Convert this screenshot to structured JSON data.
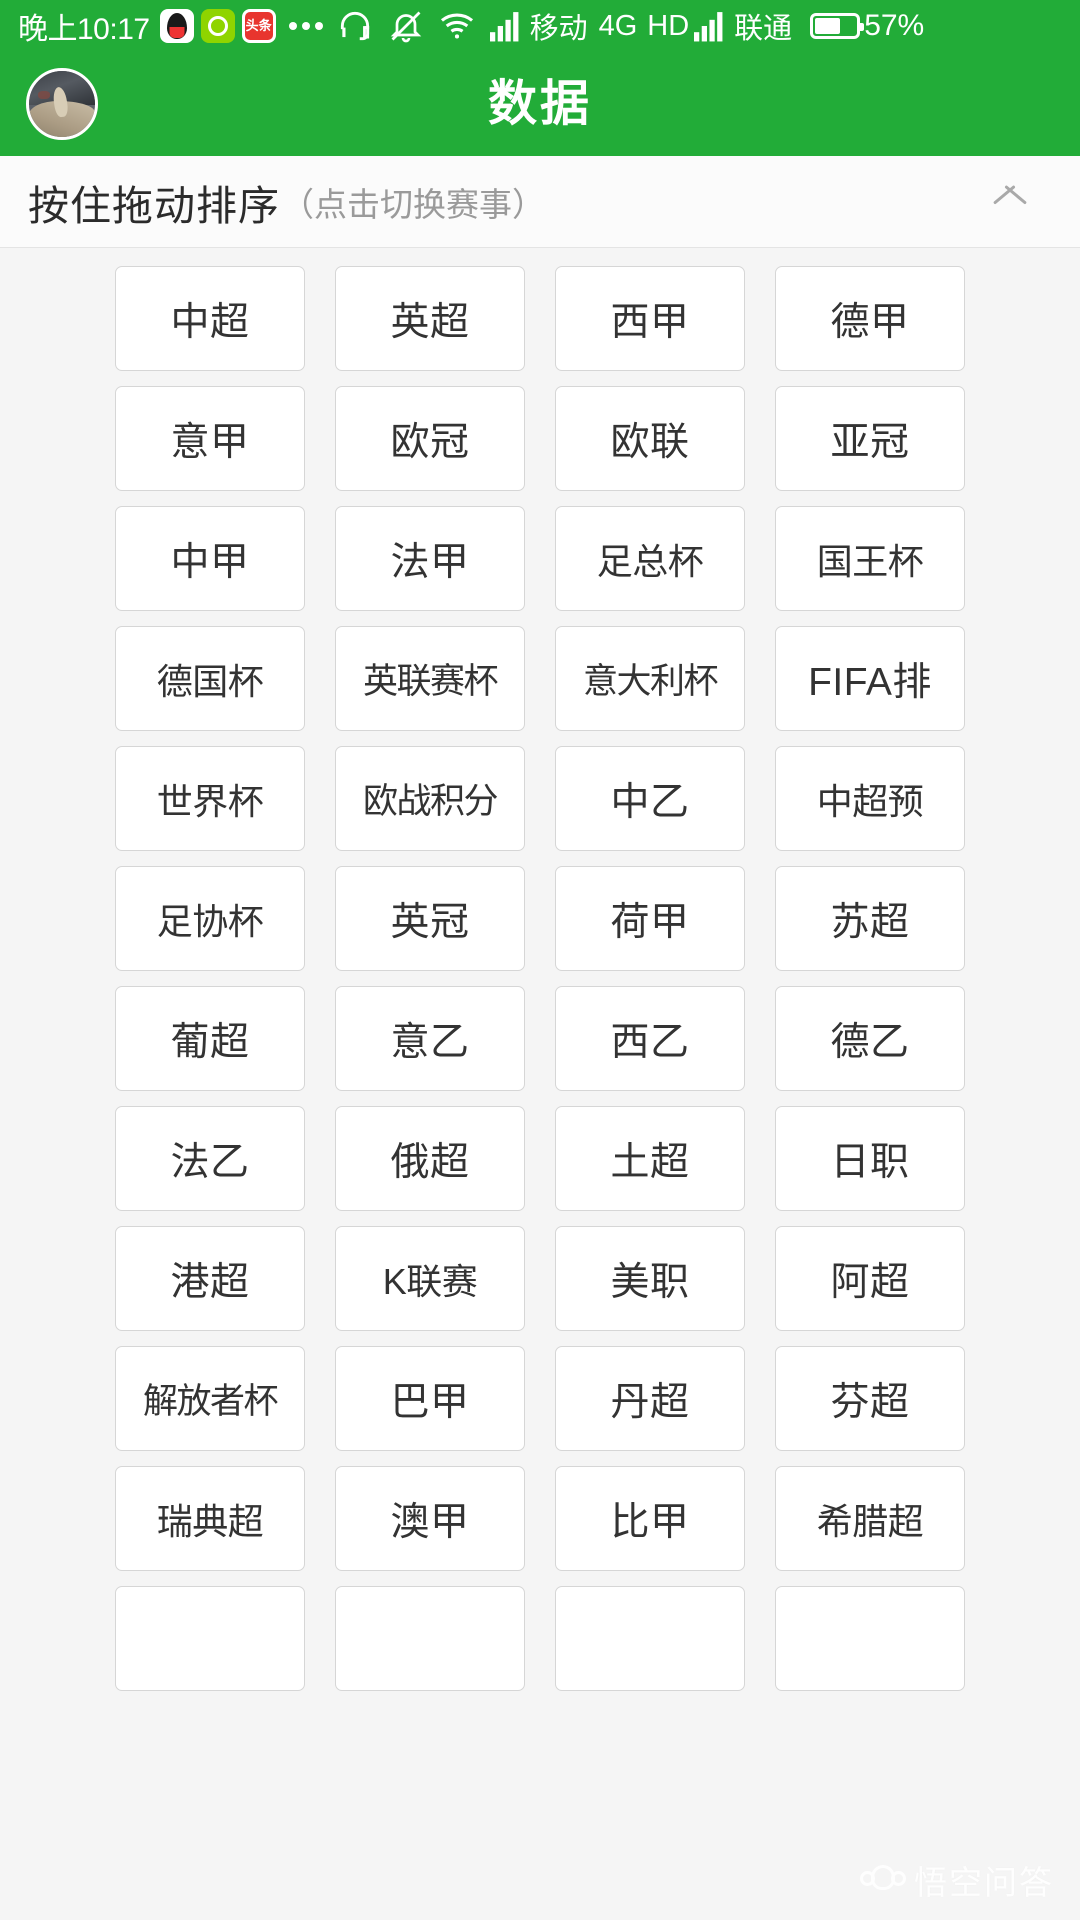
{
  "status_bar": {
    "time": "晚上10:17",
    "icons": [
      "qq-icon",
      "green-app-icon",
      "toutiao-icon",
      "more-dots-icon",
      "headset-icon",
      "bell-muted-icon",
      "wifi-icon",
      "signal-bars-icon"
    ],
    "toutiao_label": "头条",
    "carrier_primary": "移动",
    "network_type": "4G",
    "hd_label": "HD",
    "carrier_secondary": "联通",
    "battery_percent": "57%",
    "battery_level": 57,
    "background_color": "#22ac38"
  },
  "header": {
    "title": "数据",
    "avatar_name": "user-avatar",
    "background_color": "#22ac38"
  },
  "section_header": {
    "main_text": "按住拖动排序",
    "sub_text": "（点击切换赛事）",
    "collapse_icon": "chevron-up-icon"
  },
  "grid": {
    "columns": 4,
    "items": [
      "中超",
      "英超",
      "西甲",
      "德甲",
      "意甲",
      "欧冠",
      "欧联",
      "亚冠",
      "中甲",
      "法甲",
      "足总杯",
      "国王杯",
      "德国杯",
      "英联赛杯",
      "意大利杯",
      "FIFA排",
      "世界杯",
      "欧战积分",
      "中乙",
      "中超预",
      "足协杯",
      "英冠",
      "荷甲",
      "苏超",
      "葡超",
      "意乙",
      "西乙",
      "德乙",
      "法乙",
      "俄超",
      "土超",
      "日职",
      "港超",
      "K联赛",
      "美职",
      "阿超",
      "解放者杯",
      "巴甲",
      "丹超",
      "芬超",
      "瑞典超",
      "澳甲",
      "比甲",
      "希腊超",
      "",
      "",
      "",
      ""
    ]
  },
  "watermark": {
    "text": "悟空问答",
    "logo_name": "wukong-monkey-logo"
  },
  "colors": {
    "brand_green": "#22ac38",
    "page_background": "#f5f5f5",
    "button_background": "#ffffff",
    "button_border": "#d6d6d6",
    "text_primary": "#333333",
    "text_muted": "#9a9a9a"
  }
}
